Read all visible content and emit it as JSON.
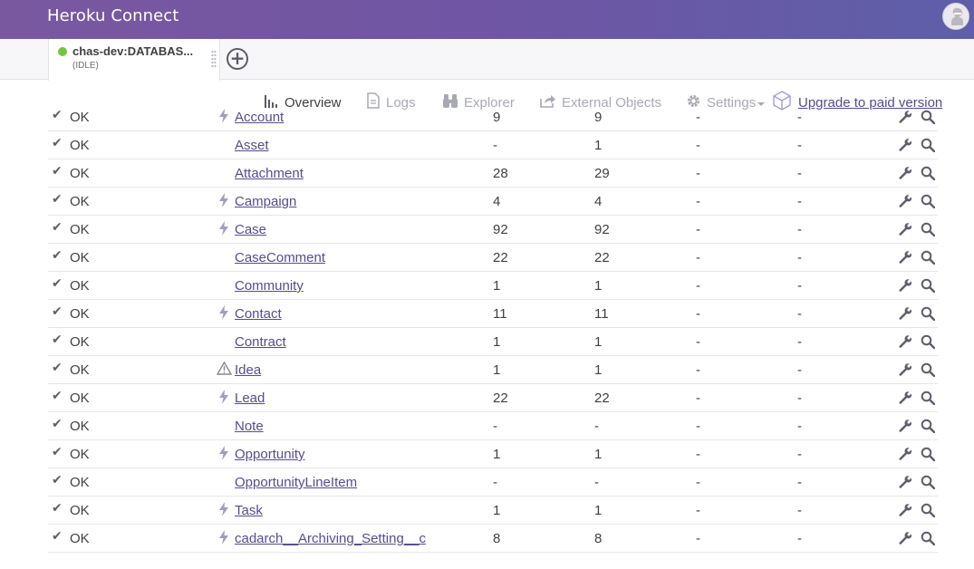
{
  "app": {
    "title": "Heroku Connect"
  },
  "connection_tab": {
    "name": "chas-dev:DATABAS...",
    "state": "(IDLE)",
    "status_color": "#6fc83c"
  },
  "nav": {
    "overview": "Overview",
    "logs": "Logs",
    "explorer": "Explorer",
    "external_objects": "External Objects",
    "settings": "Settings",
    "upgrade": "Upgrade to paid version"
  },
  "colors": {
    "header_start": "#79589f",
    "header_end": "#5e5fa8",
    "link": "#574b8e",
    "muted": "#a9a9b3"
  },
  "rows": [
    {
      "status": "OK",
      "flag": "bolt",
      "object": "Account",
      "c1": "9",
      "c2": "9",
      "c3": "-",
      "c4": "-"
    },
    {
      "status": "OK",
      "flag": "",
      "object": "Asset",
      "c1": "-",
      "c2": "1",
      "c3": "-",
      "c4": "-"
    },
    {
      "status": "OK",
      "flag": "",
      "object": "Attachment",
      "c1": "28",
      "c2": "29",
      "c3": "-",
      "c4": "-"
    },
    {
      "status": "OK",
      "flag": "bolt",
      "object": "Campaign",
      "c1": "4",
      "c2": "4",
      "c3": "-",
      "c4": "-"
    },
    {
      "status": "OK",
      "flag": "bolt",
      "object": "Case",
      "c1": "92",
      "c2": "92",
      "c3": "-",
      "c4": "-"
    },
    {
      "status": "OK",
      "flag": "",
      "object": "CaseComment",
      "c1": "22",
      "c2": "22",
      "c3": "-",
      "c4": "-"
    },
    {
      "status": "OK",
      "flag": "",
      "object": "Community",
      "c1": "1",
      "c2": "1",
      "c3": "-",
      "c4": "-"
    },
    {
      "status": "OK",
      "flag": "bolt",
      "object": "Contact",
      "c1": "11",
      "c2": "11",
      "c3": "-",
      "c4": "-"
    },
    {
      "status": "OK",
      "flag": "",
      "object": "Contract",
      "c1": "1",
      "c2": "1",
      "c3": "-",
      "c4": "-"
    },
    {
      "status": "OK",
      "flag": "warning",
      "object": "Idea",
      "c1": "1",
      "c2": "1",
      "c3": "-",
      "c4": "-"
    },
    {
      "status": "OK",
      "flag": "bolt",
      "object": "Lead",
      "c1": "22",
      "c2": "22",
      "c3": "-",
      "c4": "-"
    },
    {
      "status": "OK",
      "flag": "",
      "object": "Note",
      "c1": "-",
      "c2": "-",
      "c3": "-",
      "c4": "-"
    },
    {
      "status": "OK",
      "flag": "bolt",
      "object": "Opportunity",
      "c1": "1",
      "c2": "1",
      "c3": "-",
      "c4": "-"
    },
    {
      "status": "OK",
      "flag": "",
      "object": "OpportunityLineItem",
      "c1": "-",
      "c2": "-",
      "c3": "-",
      "c4": "-"
    },
    {
      "status": "OK",
      "flag": "bolt",
      "object": "Task",
      "c1": "1",
      "c2": "1",
      "c3": "-",
      "c4": "-"
    },
    {
      "status": "OK",
      "flag": "bolt",
      "object": "cadarch__Archiving_Setting__c",
      "c1": "8",
      "c2": "8",
      "c3": "-",
      "c4": "-"
    }
  ]
}
